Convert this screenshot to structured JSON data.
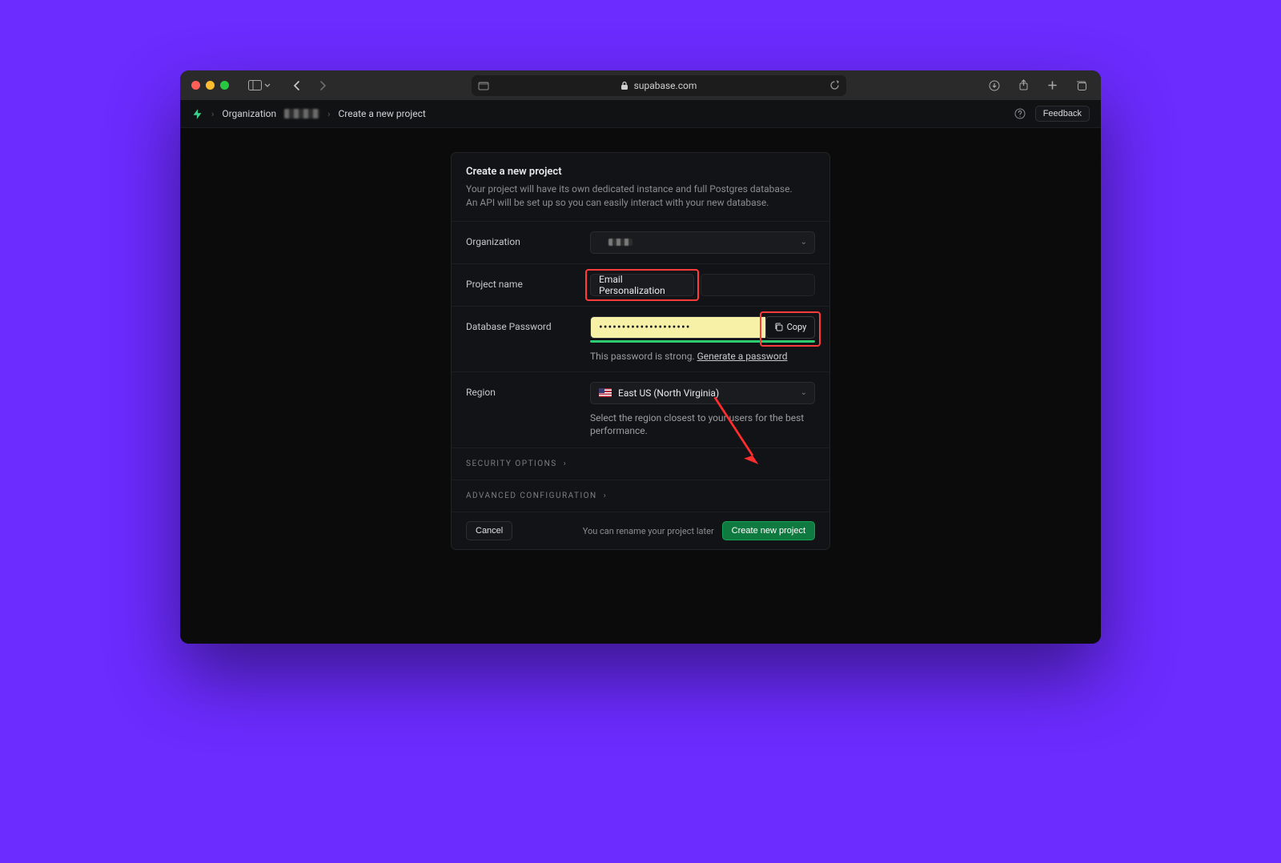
{
  "browser": {
    "domain": "supabase.com"
  },
  "header": {
    "org_label": "Organization",
    "breadcrumb_current": "Create a new project",
    "feedback": "Feedback"
  },
  "card": {
    "title": "Create a new project",
    "sub1": "Your project will have its own dedicated instance and full Postgres database.",
    "sub2": "An API will be set up so you can easily interact with your new database.",
    "organization": {
      "label": "Organization"
    },
    "project_name": {
      "label": "Project name",
      "value": "Email Personalization"
    },
    "password": {
      "label": "Database Password",
      "masked": "••••••••••••••••••••",
      "copy": "Copy",
      "strength_text": "This password is strong.",
      "generate": "Generate a password"
    },
    "region": {
      "label": "Region",
      "value": "East US (North Virginia)",
      "help": "Select the region closest to your users for the best performance."
    },
    "security_options": "SECURITY OPTIONS",
    "advanced_config": "ADVANCED CONFIGURATION",
    "footer": {
      "cancel": "Cancel",
      "rename_note": "You can rename your project later",
      "create": "Create new project"
    }
  }
}
